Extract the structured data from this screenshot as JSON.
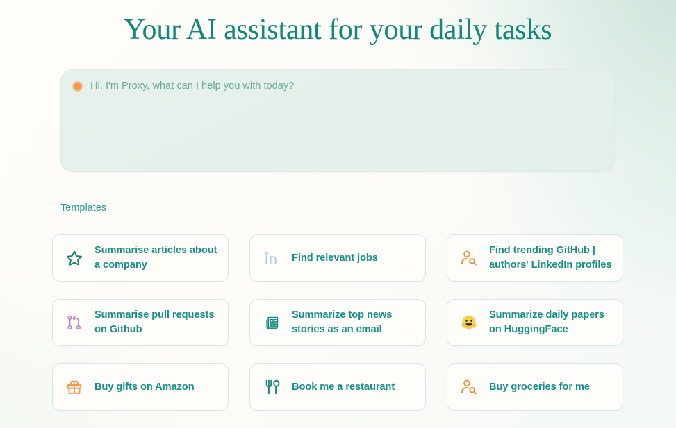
{
  "hero": {
    "title": "Your AI assistant for your daily tasks"
  },
  "composer": {
    "placeholder": "Hi, I'm Proxy, what can I help you with today?",
    "value": "",
    "avatar_icon": "proxy-orb-icon"
  },
  "templates": {
    "section_label": "Templates",
    "items": [
      {
        "label": "Summarise articles about a company",
        "icon": "star-icon",
        "icon_color": "#157f73"
      },
      {
        "label": "Find relevant jobs",
        "icon": "linkedin-icon",
        "icon_color": "#a8cfe4"
      },
      {
        "label": "Find trending GitHub | authors' LinkedIn profiles",
        "icon": "person-search-icon",
        "icon_color": "#f0913f"
      },
      {
        "label": "Summarise pull requests on Github",
        "icon": "git-pull-request-icon",
        "icon_color": "#bb8ccc"
      },
      {
        "label": "Summarize top news stories as an email",
        "icon": "newspaper-icon",
        "icon_color": "#168f81"
      },
      {
        "label": "Summarize daily papers on HuggingFace",
        "icon": "hugging-face-emoji",
        "icon_color": "#f5c948"
      },
      {
        "label": "Buy gifts on Amazon",
        "icon": "gift-icon",
        "icon_color": "#f2954a"
      },
      {
        "label": "Book me a restaurant",
        "icon": "utensils-icon",
        "icon_color": "#17877a"
      },
      {
        "label": "Buy groceries for me",
        "icon": "person-search-icon",
        "icon_color": "#f0913f"
      }
    ]
  },
  "theme": {
    "accent_teal": "#179184",
    "heading_teal": "#10877a",
    "accent_orange": "#f0913f",
    "page_bg": "#fefdf9",
    "composer_bg": "#e6f0eb",
    "card_border": "#d5e9e2"
  }
}
